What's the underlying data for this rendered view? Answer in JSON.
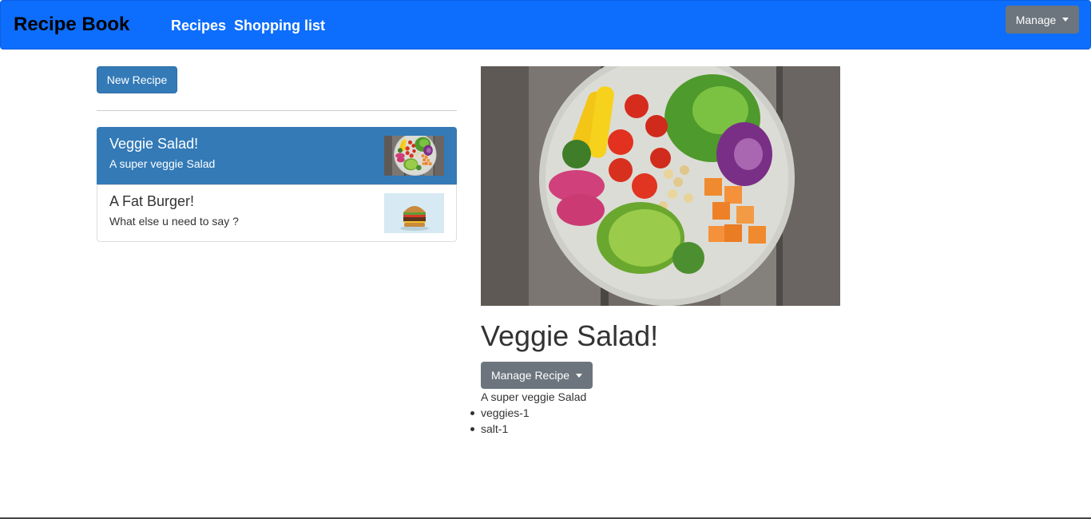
{
  "navbar": {
    "brand": "Recipe Book",
    "links": [
      "Recipes",
      "Shopping list"
    ],
    "manage_label": "Manage"
  },
  "sidebar": {
    "new_recipe_label": "New Recipe",
    "recipes": [
      {
        "name": "Veggie Salad!",
        "description": "A super veggie Salad",
        "active": true,
        "thumbnail": "salad-bowl-image"
      },
      {
        "name": "A Fat Burger!",
        "description": "What else u need to say ?",
        "active": false,
        "thumbnail": "burger-image"
      }
    ]
  },
  "detail": {
    "image": "salad-bowl-image",
    "title": "Veggie Salad!",
    "manage_label": "Manage Recipe",
    "description": "A super veggie Salad",
    "ingredients": [
      "veggies-1",
      "salt-1"
    ]
  },
  "colors": {
    "navbar": "#0d6efd",
    "primary_button": "#337ab7",
    "secondary_button": "#6c757d"
  }
}
